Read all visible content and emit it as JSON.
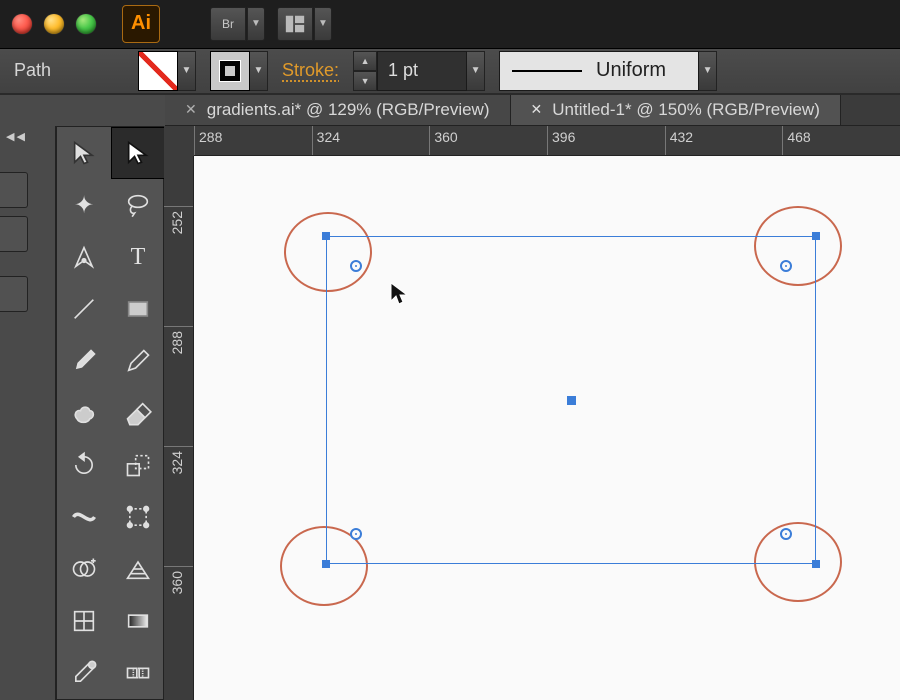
{
  "app": {
    "name_short": "Ai",
    "bridge_label": "Br"
  },
  "controlbar": {
    "selection_type": "Path",
    "stroke_label": "Stroke:",
    "stroke_value": "1 pt",
    "profile_label": "Uniform"
  },
  "tabs": [
    {
      "label": "gradients.ai* @ 129% (RGB/Preview)",
      "active": false
    },
    {
      "label": "Untitled-1* @ 150% (RGB/Preview)",
      "active": true
    }
  ],
  "ruler_h": [
    "288",
    "324",
    "360",
    "396",
    "432",
    "468"
  ],
  "ruler_v": [
    "252",
    "288",
    "324",
    "360"
  ],
  "tools": [
    "selection",
    "direct-selection",
    "magic-wand",
    "lasso",
    "pen",
    "type",
    "line-segment",
    "rectangle",
    "paintbrush",
    "pencil",
    "blob-brush",
    "eraser",
    "rotate",
    "scale",
    "width",
    "free-transform",
    "shape-builder",
    "perspective-grid",
    "mesh",
    "gradient",
    "eyedropper",
    "blend"
  ],
  "selected_tool": "direct-selection",
  "colors": {
    "selection": "#3b7dd8",
    "annotation": "#c9684e",
    "accent": "#ff8f00"
  }
}
